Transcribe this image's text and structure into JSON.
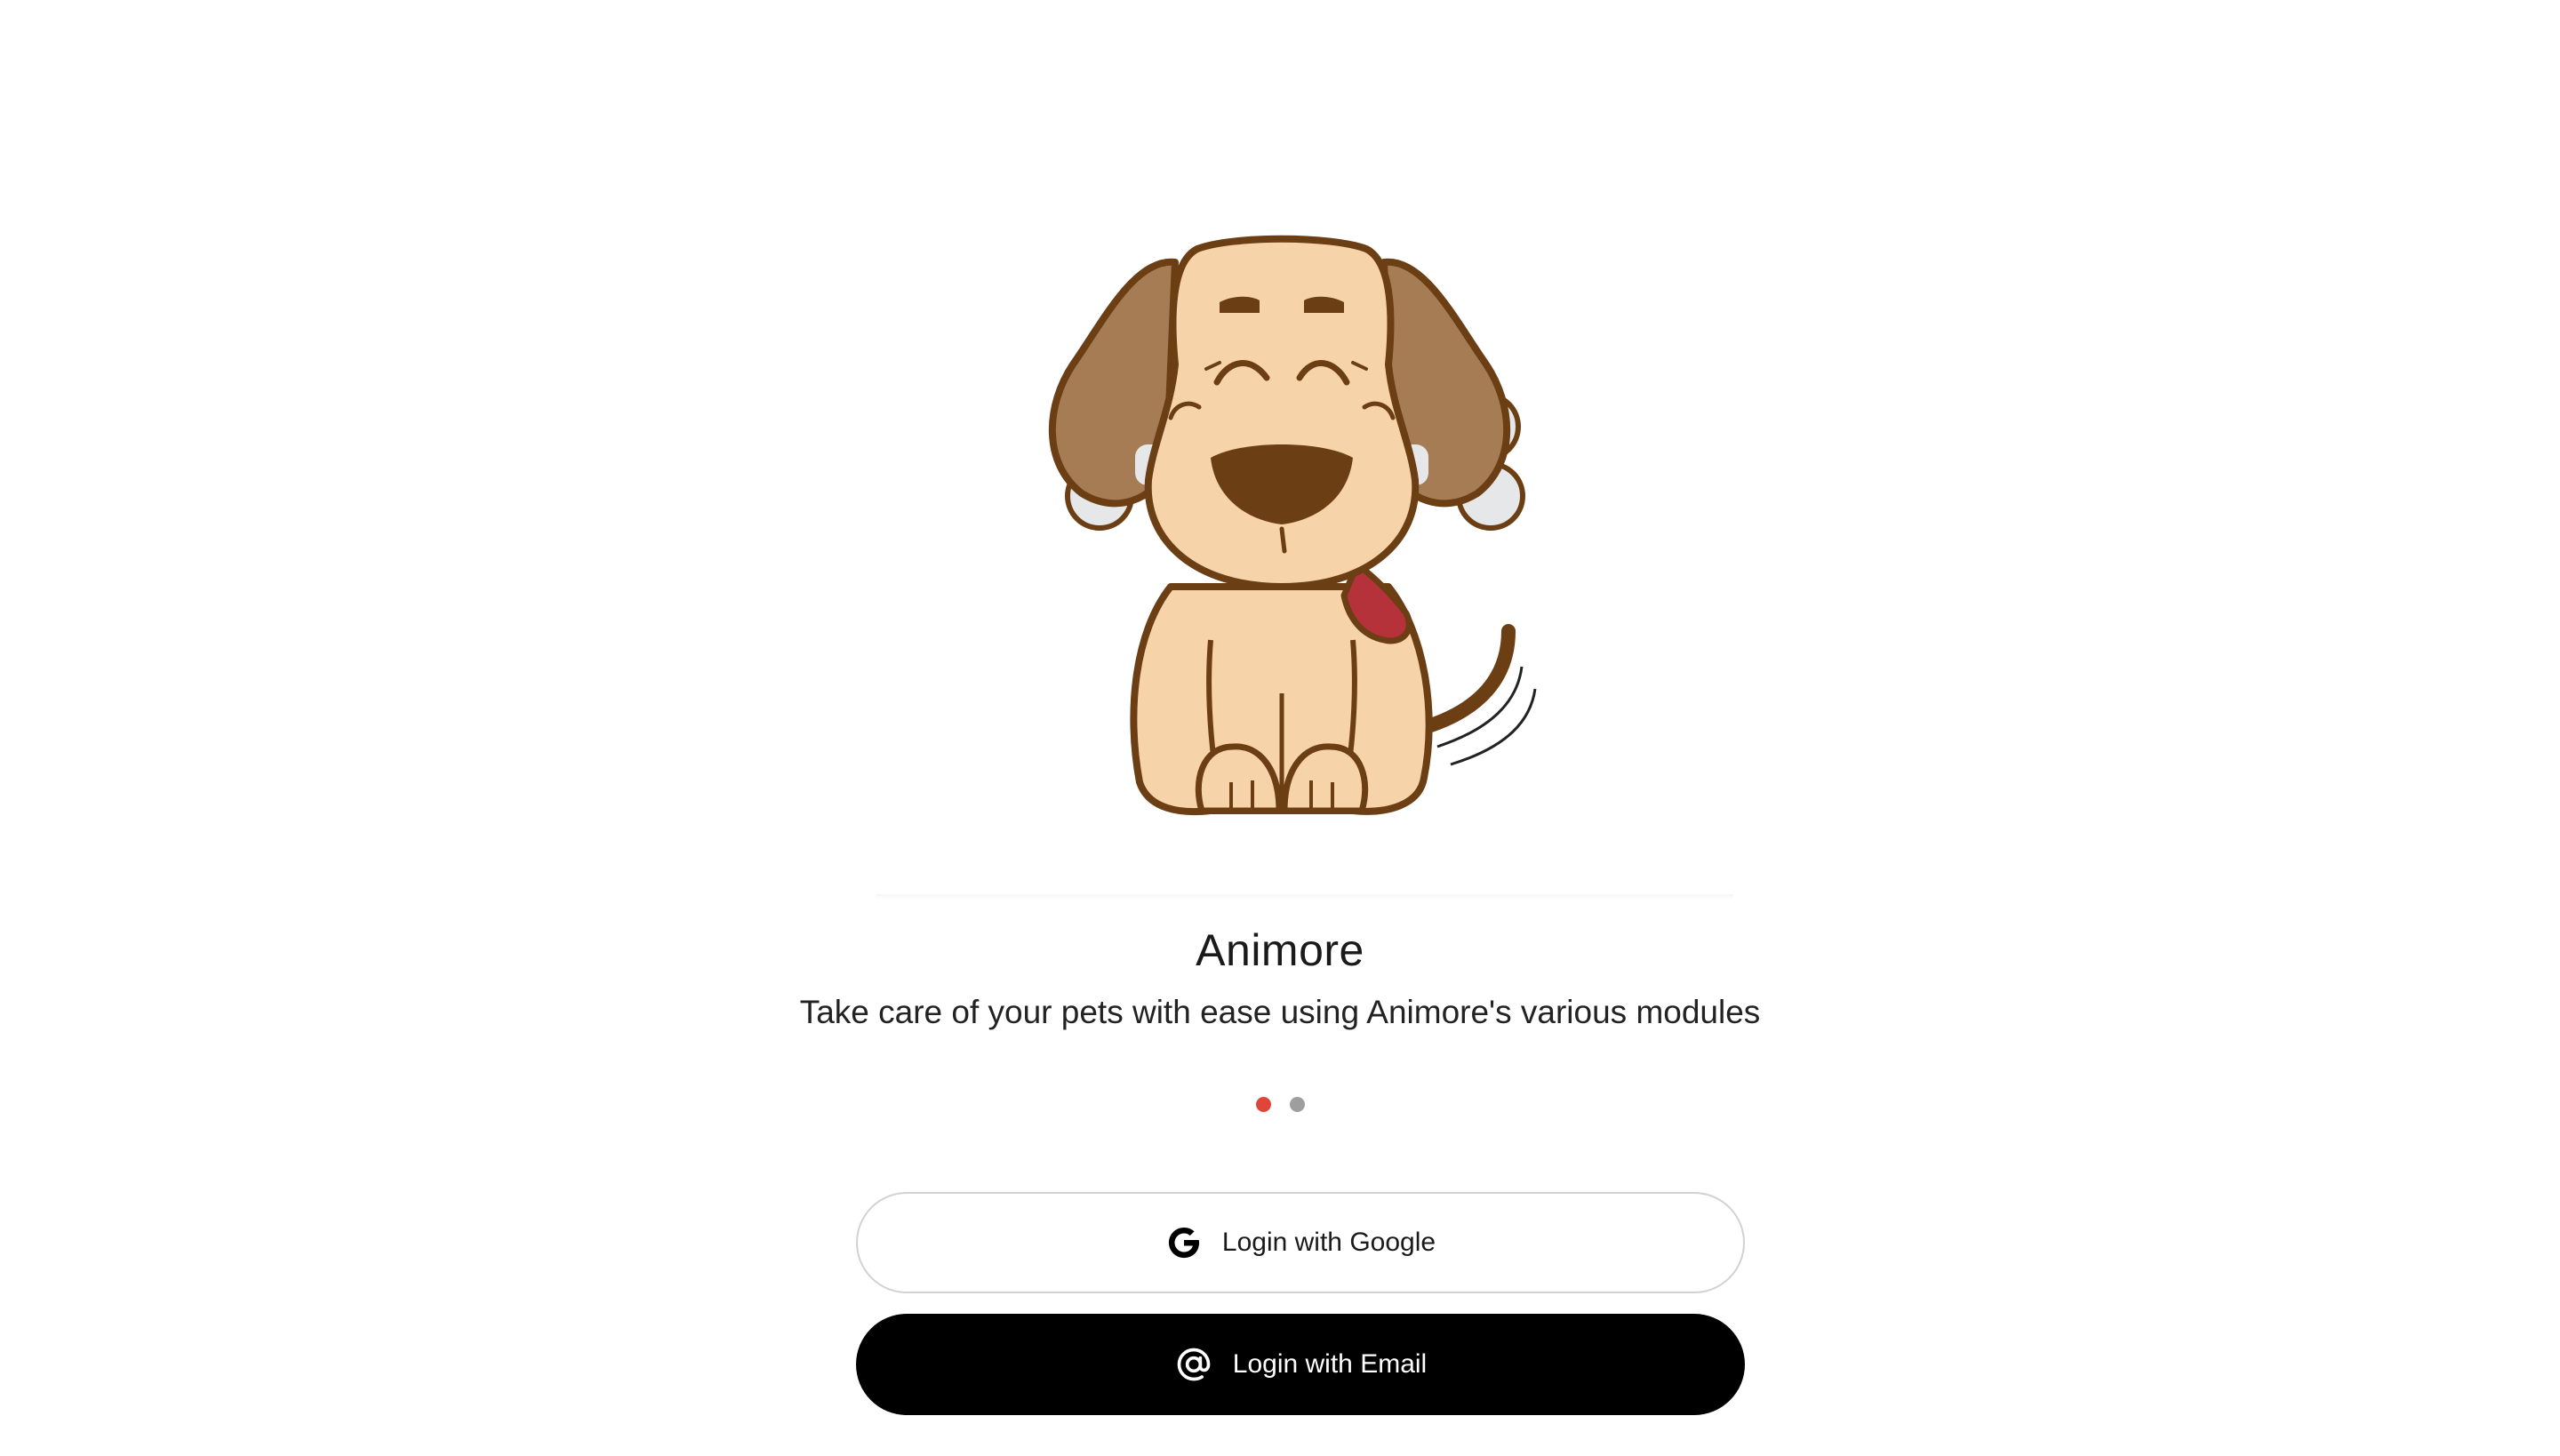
{
  "onboarding": {
    "title": "Animore",
    "subtitle": "Take care of your pets with ease using Animore's various modules",
    "carousel": {
      "total_pages": 2,
      "active_page": 1,
      "active_color": "#e0453a",
      "inactive_color": "#9e9e9e"
    }
  },
  "auth": {
    "google_label": "Login with Google",
    "email_label": "Login with Email"
  },
  "icons": {
    "google": "google-g-icon",
    "email": "at-sign-icon",
    "illustration": "happy-dog-illustration"
  },
  "colors": {
    "background": "#ffffff",
    "email_button": "#000000",
    "google_button_border": "#d2d2d2"
  }
}
